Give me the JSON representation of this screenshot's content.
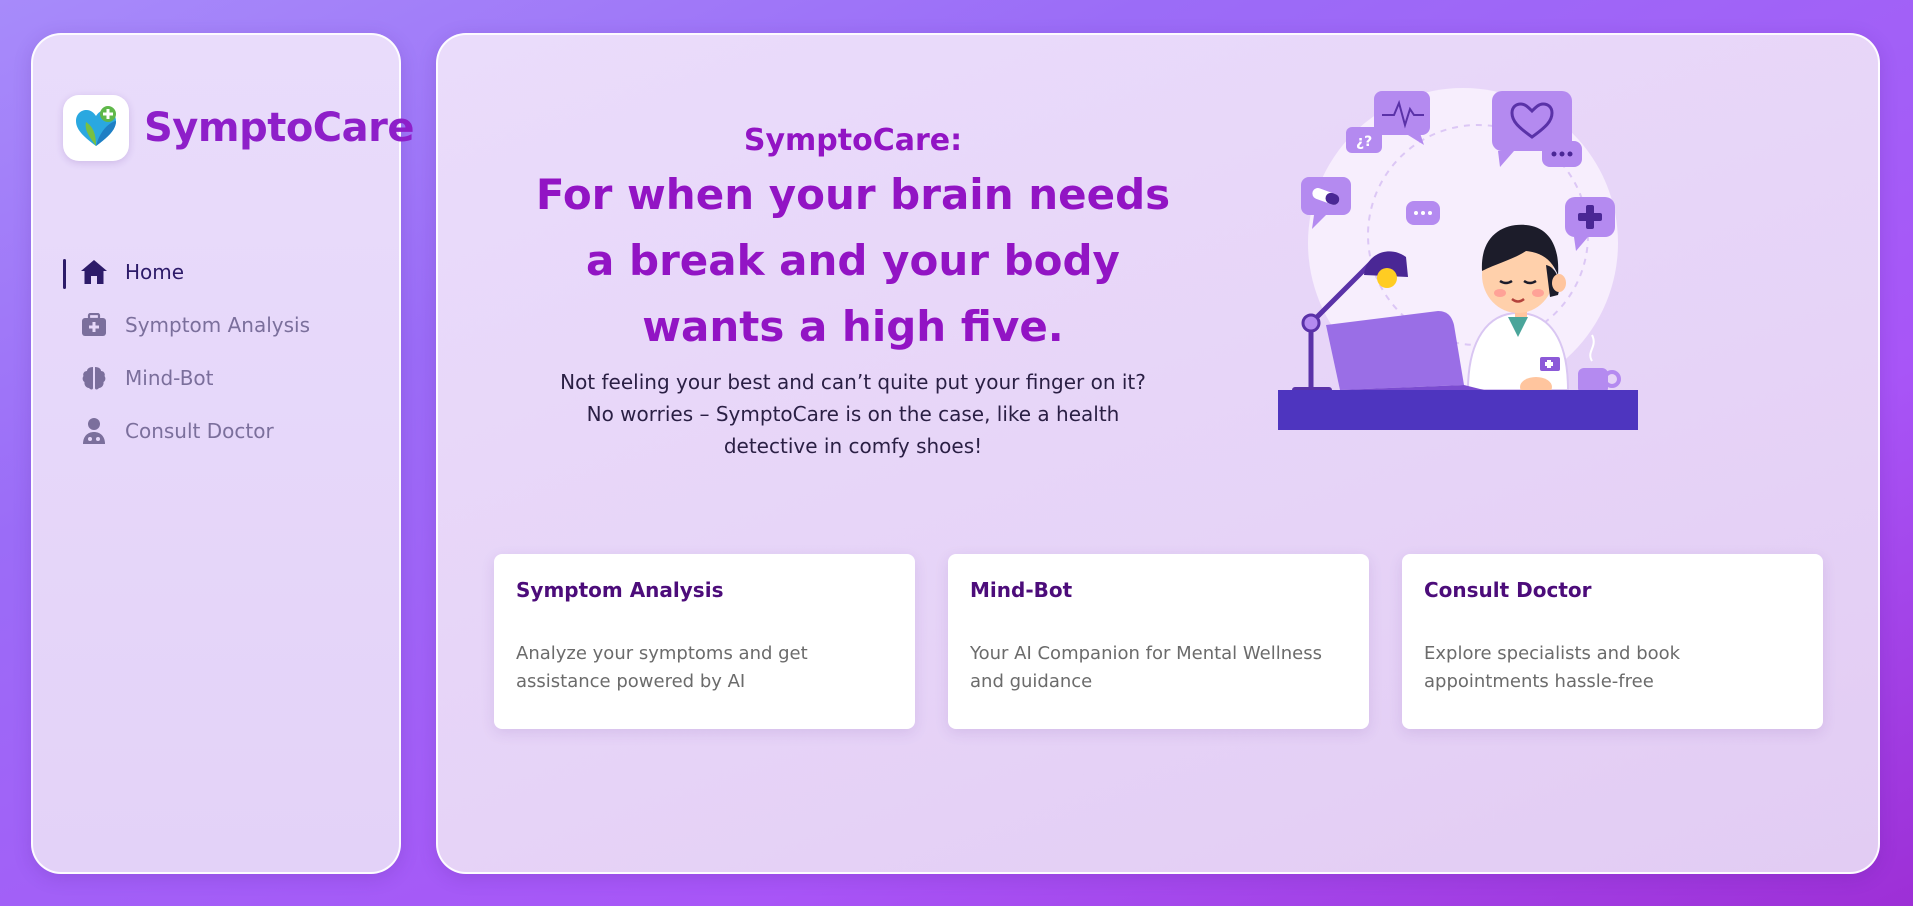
{
  "brand": {
    "name": "SymptoCare",
    "logo_icon": "heart-plus-icon"
  },
  "sidebar": {
    "items": [
      {
        "label": "Home",
        "icon": "home-icon",
        "active": true
      },
      {
        "label": "Symptom Analysis",
        "icon": "medical-kit-icon",
        "active": false
      },
      {
        "label": "Mind-Bot",
        "icon": "brain-icon",
        "active": false
      },
      {
        "label": "Consult Doctor",
        "icon": "doctor-icon",
        "active": false
      }
    ]
  },
  "hero": {
    "kicker": "SymptoCare:",
    "headline": "For when your brain needs a break and your body wants a high five.",
    "subtext": "Not feeling your best and can’t quite put your finger on it? No worries – SymptoCare is on the case, like a health detective in comfy shoes!",
    "illustration": "doctor-at-laptop-illustration"
  },
  "cards": [
    {
      "title": "Symptom Analysis",
      "description": "Analyze your symptoms and get assistance powered by AI"
    },
    {
      "title": "Mind-Bot",
      "description": "Your AI Companion for Mental Wellness and guidance"
    },
    {
      "title": "Consult Doctor",
      "description": "Explore specialists and book appointments hassle-free"
    }
  ],
  "colors": {
    "brand": "#8e1fc9",
    "headline": "#9214c4",
    "nav_active": "#2d1b69",
    "nav_inactive": "#7b6f9c",
    "card_title": "#4c0c7a"
  }
}
